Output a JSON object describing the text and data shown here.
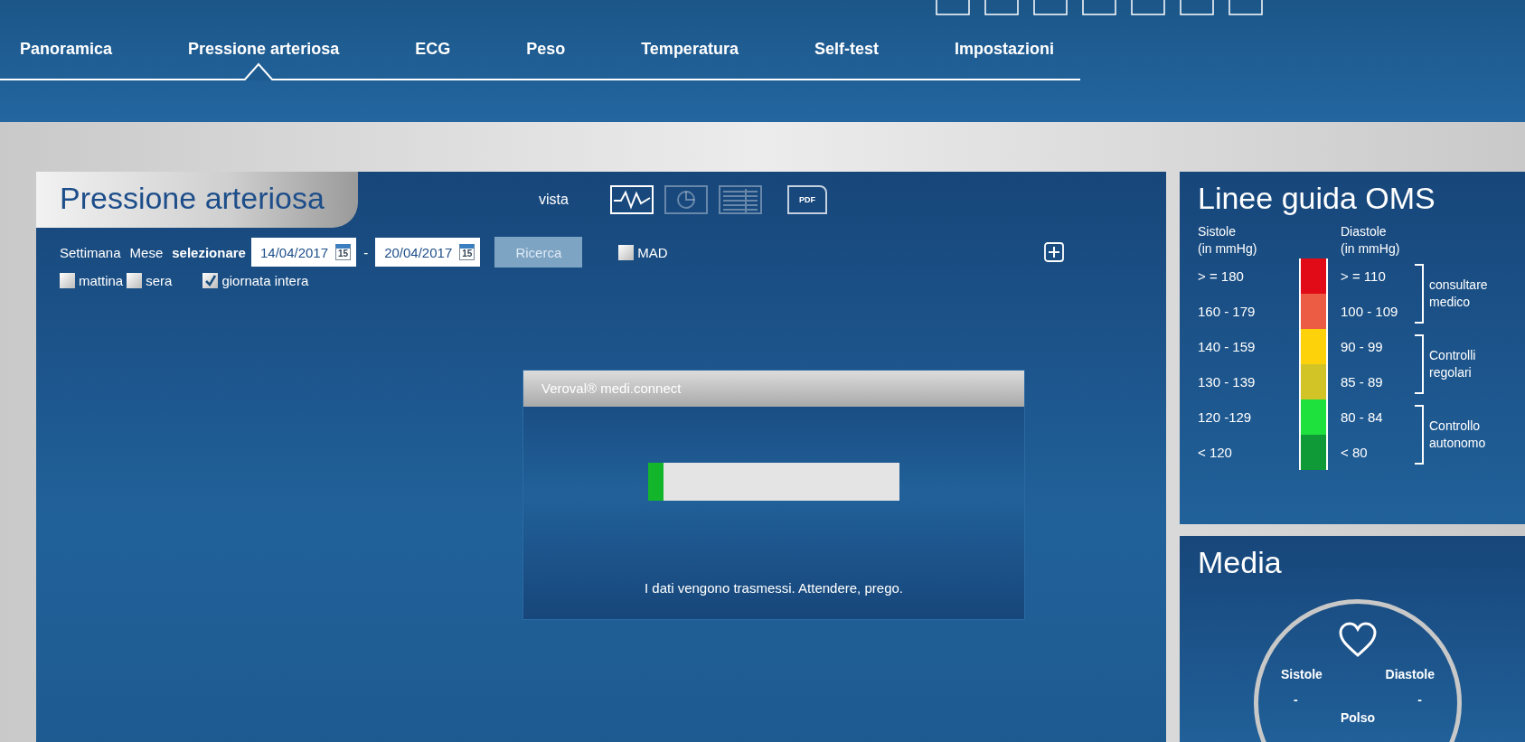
{
  "nav": {
    "tabs": [
      {
        "label": "Panoramica",
        "selected": false
      },
      {
        "label": "Pressione arteriosa",
        "selected": true
      },
      {
        "label": "ECG",
        "selected": false
      },
      {
        "label": "Peso",
        "selected": false
      },
      {
        "label": "Temperatura",
        "selected": false
      },
      {
        "label": "Self-test",
        "selected": false
      },
      {
        "label": "Impostazioni",
        "selected": false
      }
    ]
  },
  "panel": {
    "title": "Pressione arteriosa",
    "view_label": "vista",
    "views": [
      {
        "kind": "line",
        "selected": true
      },
      {
        "kind": "pie",
        "selected": false
      },
      {
        "kind": "table",
        "selected": false
      },
      {
        "kind": "pdf",
        "label": "PDF",
        "selected": false
      }
    ],
    "period_options": [
      "Settimana",
      "Mese"
    ],
    "select_label": "selezionare",
    "date_from": {
      "value": "14/04/2017",
      "calendar_day": "15"
    },
    "separator": "-",
    "date_to": {
      "value": "20/04/2017",
      "calendar_day": "15"
    },
    "search_button": "Ricerca",
    "mad": {
      "label": "MAD",
      "checked": false
    },
    "time_filters": [
      {
        "label": "mattina",
        "checked": false
      },
      {
        "label": "sera",
        "checked": false
      },
      {
        "label": "giornata intera",
        "checked": true
      }
    ]
  },
  "dialog": {
    "title": "Veroval® medi.connect",
    "progress": {
      "level": 0.06
    },
    "message": "I dati vengono trasmessi. Attendere, prego."
  },
  "guidelines": {
    "title": "Linee guida OMS",
    "systole_header": "Sistole",
    "systole_unit": "(in mmHg)",
    "diastole_header": "Diastole",
    "diastole_unit": "(in mmHg)",
    "rows": [
      {
        "systole": "> = 180",
        "diastole": "> = 110",
        "color": "#e10a17"
      },
      {
        "systole": "160 - 179",
        "diastole": "100 - 109",
        "color": "#ec5c45"
      },
      {
        "systole": "140 - 159",
        "diastole": "90 - 99",
        "color": "#fdd20a"
      },
      {
        "systole": "130 - 139",
        "diastole": "85 - 89",
        "color": "#d2c426"
      },
      {
        "systole": "120 -129",
        "diastole": "80 - 84",
        "color": "#1fe13d"
      },
      {
        "systole": "< 120",
        "diastole": "< 80",
        "color": "#0f9a37"
      }
    ],
    "groups": [
      {
        "lines": [
          "consultare",
          "medico"
        ]
      },
      {
        "lines": [
          "Controlli",
          "regolari"
        ]
      },
      {
        "lines": [
          "Controllo",
          "autonomo"
        ]
      }
    ]
  },
  "average": {
    "title": "Media",
    "systole_label": "Sistole",
    "systole_value": "-",
    "diastole_label": "Diastole",
    "diastole_value": "-",
    "pulse_label": "Polso"
  }
}
